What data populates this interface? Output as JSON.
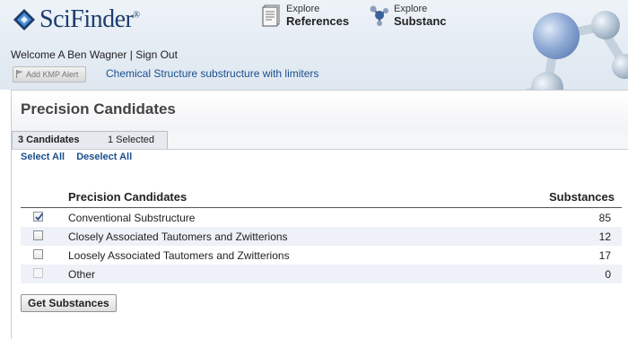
{
  "brand": {
    "name": "SciFinder",
    "registered": "®"
  },
  "nav": [
    {
      "top": "Explore",
      "bottom": "References"
    },
    {
      "top": "Explore",
      "bottom": "Substanc"
    }
  ],
  "user": {
    "welcome": "Welcome A Ben Wagner",
    "separator": "|",
    "signout": "Sign Out"
  },
  "kmp_alert": "Add KMP Alert",
  "query_label": "Chemical Structure substructure with limiters",
  "panel": {
    "title": "Precision Candidates",
    "tab_count": "3 Candidates",
    "tab_selected": "1  Selected",
    "select_all": "Select All",
    "deselect_all": "Deselect All"
  },
  "table": {
    "columns": [
      "Precision Candidates",
      "Substances"
    ],
    "rows": [
      {
        "name": "Conventional Substructure",
        "value": "85",
        "checked": true,
        "enabled": true
      },
      {
        "name": "Closely Associated Tautomers and Zwitterions",
        "value": "12",
        "checked": false,
        "enabled": true
      },
      {
        "name": "Loosely Associated Tautomers and Zwitterions",
        "value": "17",
        "checked": false,
        "enabled": true
      },
      {
        "name": "Other",
        "value": "0",
        "checked": false,
        "enabled": false
      }
    ]
  },
  "get_button": "Get Substances",
  "colors": {
    "link": "#1a4f8f",
    "brand": "#1d3c6e",
    "row_alt": "#eef1f7"
  }
}
